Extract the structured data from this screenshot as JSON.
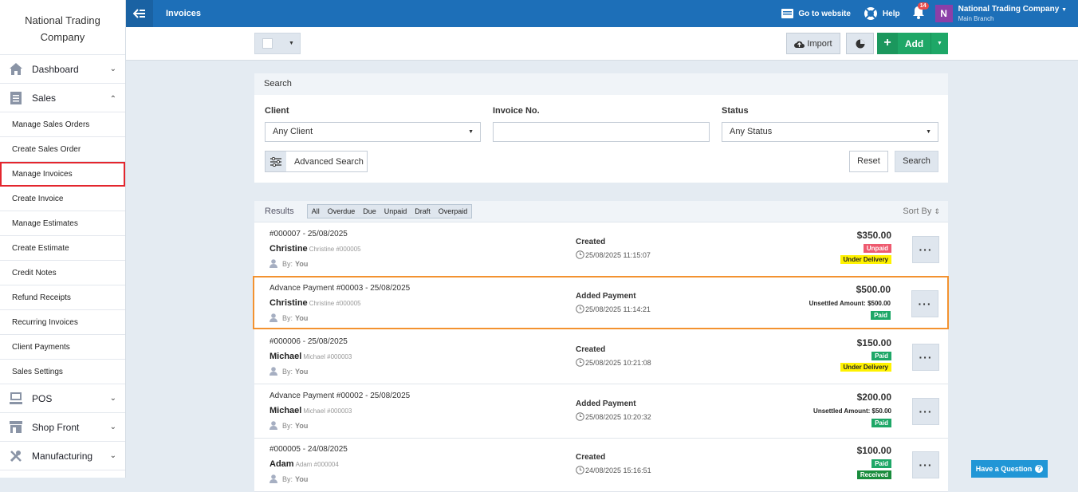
{
  "brand": {
    "line1": "National Trading",
    "line2": "Company"
  },
  "sidebar": {
    "top": [
      {
        "label": "Dashboard"
      },
      {
        "label": "Sales"
      }
    ],
    "sub": [
      "Manage Sales Orders",
      "Create Sales Order",
      "Manage Invoices",
      "Create Invoice",
      "Manage Estimates",
      "Create Estimate",
      "Credit Notes",
      "Refund Receipts",
      "Recurring Invoices",
      "Client Payments",
      "Sales Settings"
    ],
    "bottom": [
      {
        "label": "POS"
      },
      {
        "label": "Shop Front"
      },
      {
        "label": "Manufacturing"
      }
    ]
  },
  "topbar": {
    "title": "Invoices",
    "go_website": "Go to website",
    "help": "Help",
    "notif_count": "14",
    "avatar": "N",
    "account": "National Trading Company",
    "branch": "Main Branch"
  },
  "toolbar": {
    "import": "Import",
    "add": "Add"
  },
  "search": {
    "heading": "Search",
    "client_label": "Client",
    "client_value": "Any Client",
    "invoice_label": "Invoice No.",
    "invoice_value": "",
    "status_label": "Status",
    "status_value": "Any Status",
    "advanced": "Advanced Search",
    "reset": "Reset",
    "search": "Search"
  },
  "results": {
    "label": "Results",
    "filters": [
      "All",
      "Overdue",
      "Due",
      "Unpaid",
      "Draft",
      "Overpaid"
    ],
    "sort": "Sort By",
    "rows": [
      {
        "ref": "#000007 - 25/08/2025",
        "client": "Christine",
        "client_code": "Christine #000005",
        "by_label": "By:",
        "by": "You",
        "action": "Created",
        "date": "25/08/2025 11:15:07",
        "amount": "$350.00",
        "unsettled": "",
        "badges": [
          {
            "text": "Unpaid",
            "type": "unpaid"
          },
          {
            "text": "Under Delivery",
            "type": "deliv"
          }
        ]
      },
      {
        "ref": "Advance Payment #00003 - 25/08/2025",
        "client": "Christine",
        "client_code": "Christine #000005",
        "by_label": "By:",
        "by": "You",
        "action": "Added Payment",
        "date": "25/08/2025 11:14:21",
        "amount": "$500.00",
        "unsettled": "Unsettled Amount: $500.00",
        "badges": [
          {
            "text": "Paid",
            "type": "paid"
          }
        ]
      },
      {
        "ref": "#000006 - 25/08/2025",
        "client": "Michael",
        "client_code": "Michael #000003",
        "by_label": "By:",
        "by": "You",
        "action": "Created",
        "date": "25/08/2025 10:21:08",
        "amount": "$150.00",
        "unsettled": "",
        "badges": [
          {
            "text": "Paid",
            "type": "paid"
          },
          {
            "text": "Under Delivery",
            "type": "deliv"
          }
        ]
      },
      {
        "ref": "Advance Payment #00002 - 25/08/2025",
        "client": "Michael",
        "client_code": "Michael #000003",
        "by_label": "By:",
        "by": "You",
        "action": "Added Payment",
        "date": "25/08/2025 10:20:32",
        "amount": "$200.00",
        "unsettled": "Unsettled Amount: $50.00",
        "badges": [
          {
            "text": "Paid",
            "type": "paid"
          }
        ]
      },
      {
        "ref": "#000005 - 24/08/2025",
        "client": "Adam",
        "client_code": "Adam #000004",
        "by_label": "By:",
        "by": "You",
        "action": "Created",
        "date": "24/08/2025 15:16:51",
        "amount": "$100.00",
        "unsettled": "",
        "badges": [
          {
            "text": "Paid",
            "type": "paid"
          },
          {
            "text": "Received",
            "type": "recv"
          }
        ]
      }
    ]
  },
  "help_widget": {
    "label": "Have a Question"
  }
}
